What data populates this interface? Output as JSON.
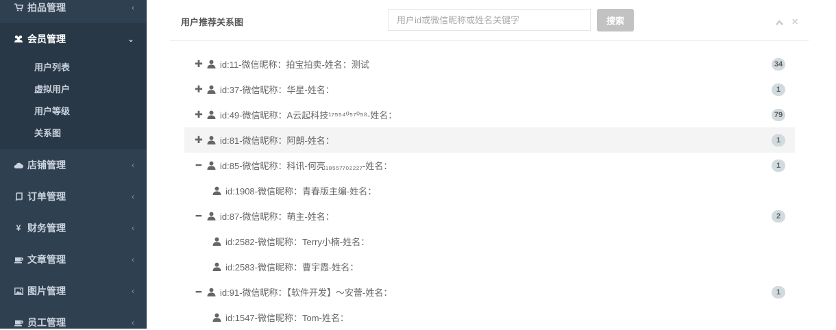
{
  "sidebar": {
    "items": [
      {
        "label": "拍品管理",
        "icon": "cart-icon",
        "arrow": "‹"
      },
      {
        "label": "会员管理",
        "icon": "users-icon",
        "arrow": "⌄"
      },
      {
        "label": "店铺管理",
        "icon": "cloud-icon",
        "arrow": "‹"
      },
      {
        "label": "订单管理",
        "icon": "book-icon",
        "arrow": "‹"
      },
      {
        "label": "财务管理",
        "icon": "yen-icon",
        "arrow": "‹"
      },
      {
        "label": "文章管理",
        "icon": "coffee-icon",
        "arrow": "‹"
      },
      {
        "label": "图片管理",
        "icon": "image-icon",
        "arrow": "‹"
      },
      {
        "label": "员工管理",
        "icon": "coffee-icon",
        "arrow": "‹"
      }
    ],
    "sub_items": [
      "用户列表",
      "虚拟用户",
      "用户等级",
      "关系图"
    ]
  },
  "panel": {
    "title": "用户推荐关系图",
    "search_placeholder": "用户id或微信昵称或姓名关键字",
    "search_button": "搜索",
    "collapse_icon": "▲",
    "close_icon": "✕"
  },
  "tree": [
    {
      "text": "id:11-微信昵称：拍宝拍卖-姓名：测试",
      "toggle": "✚",
      "badge": "34",
      "child": false
    },
    {
      "text": "id:37-微信昵称：华星-姓名：",
      "toggle": "✚",
      "badge": "1",
      "child": false
    },
    {
      "text": "id:49-微信昵称：A云起科技¹⁷⁵⁵⁴⁰⁵⁷⁰⁵⁸-姓名：",
      "toggle": "✚",
      "badge": "79",
      "child": false
    },
    {
      "text": "id:81-微信昵称：阿朗-姓名：",
      "toggle": "✚",
      "badge": "1",
      "child": false
    },
    {
      "text": "id:85-微信昵称：科讯-何亮₁₈₅₅₇₇₀₂₂₂₇-姓名：",
      "toggle": "━",
      "badge": "1",
      "child": false
    },
    {
      "text": "id:1908-微信昵称：青春版主编-姓名：",
      "toggle": "",
      "badge": "",
      "child": true
    },
    {
      "text": "id:87-微信昵称：萌主-姓名：",
      "toggle": "━",
      "badge": "2",
      "child": false
    },
    {
      "text": "id:2582-微信昵称：Terry小楠-姓名：",
      "toggle": "",
      "badge": "",
      "child": true
    },
    {
      "text": "id:2583-微信昵称：曹宇霞-姓名：",
      "toggle": "",
      "badge": "",
      "child": true
    },
    {
      "text": "id:91-微信昵称：【软件开发】～安蕾-姓名：",
      "toggle": "━",
      "badge": "1",
      "child": false
    },
    {
      "text": "id:1547-微信昵称：Tom-姓名：",
      "toggle": "",
      "badge": "",
      "child": true
    }
  ]
}
